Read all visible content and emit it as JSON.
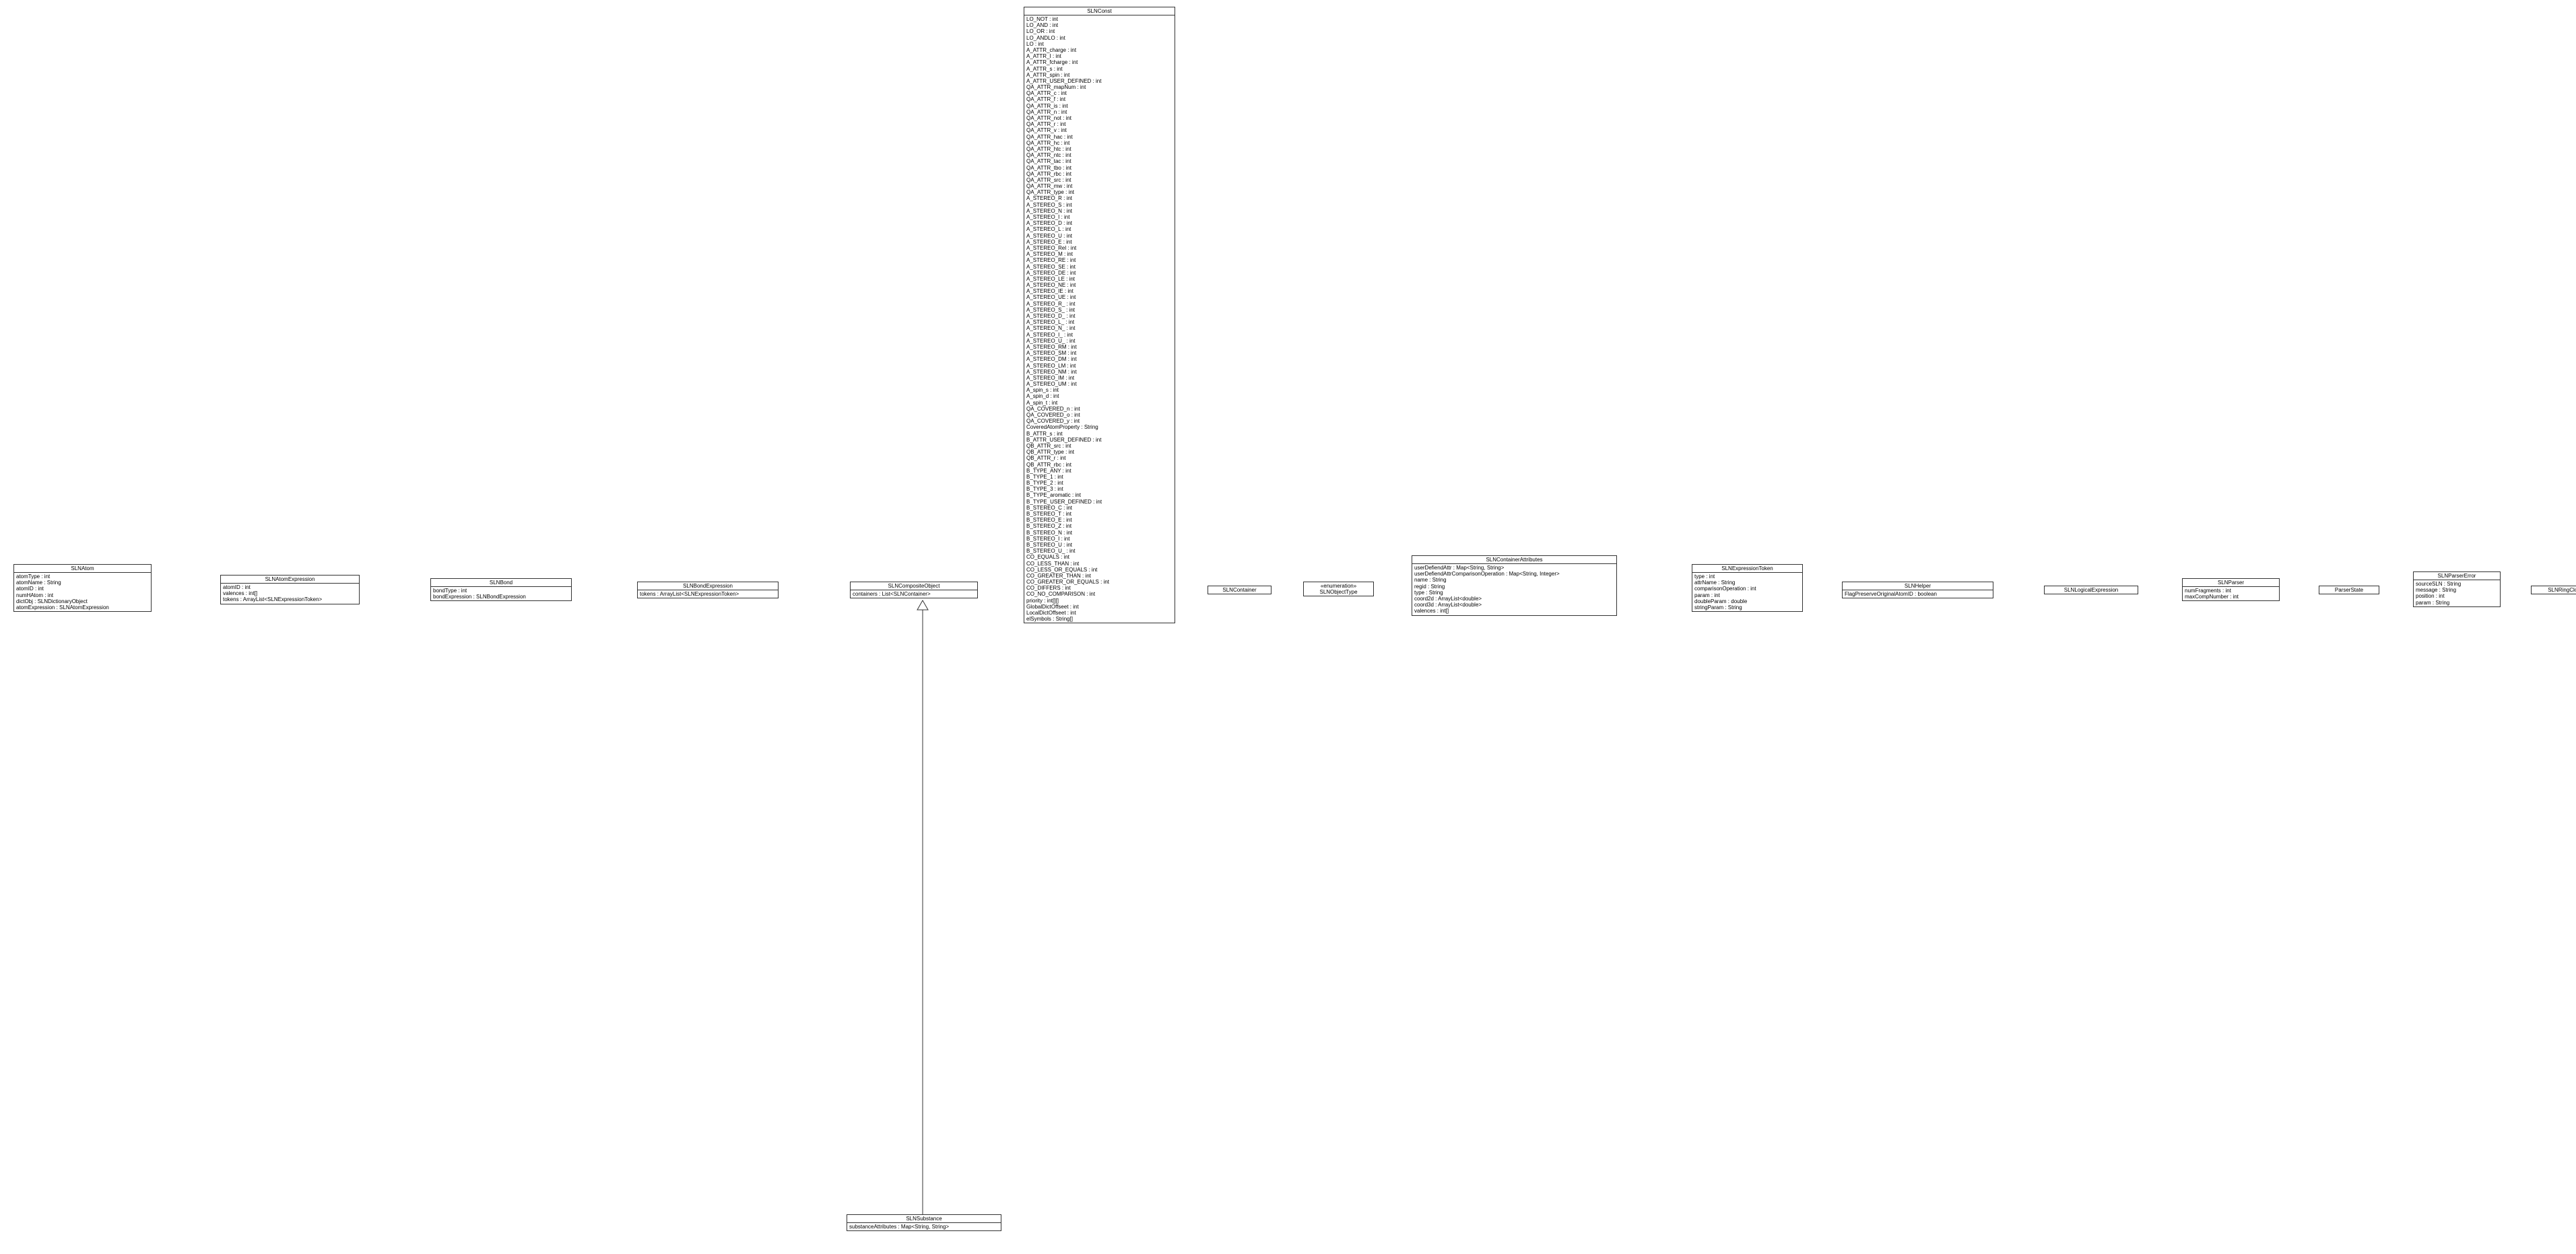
{
  "classes": {
    "SLNAtom": {
      "title": "SLNAtom",
      "attrs": [
        "atomType : int",
        "atomName : String",
        "atomID : int",
        "numHAtom : int",
        "dictObj : SLNDictionaryObject",
        "atomExpression : SLNAtomExpression"
      ]
    },
    "SLNAtomExpression": {
      "title": "SLNAtomExpression",
      "attrs": [
        "atomID : int",
        "valences : int[]",
        "tokens : ArrayList<SLNExpressionToken>"
      ]
    },
    "SLNBond": {
      "title": "SLNBond",
      "attrs": [
        "bondType : int",
        "bondExpression : SLNBondExpression"
      ]
    },
    "SLNBondExpression": {
      "title": "SLNBondExpression",
      "attrs": [
        "tokens : ArrayList<SLNExpressionToken>"
      ]
    },
    "SLNCompositeObject": {
      "title": "SLNCompositeObject",
      "attrs": [
        "containers : List<SLNContainer>"
      ]
    },
    "SLNConst": {
      "title": "SLNConst",
      "attrs": [
        "LO_NOT : int",
        "LO_AND : int",
        "LO_OR : int",
        "LO_ANDLO : int",
        "LO : int",
        "A_ATTR_charge : int",
        "A_ATTR_I : int",
        "A_ATTR_fcharge : int",
        "A_ATTR_s : int",
        "A_ATTR_spin : int",
        "A_ATTR_USER_DEFINED : int",
        "QA_ATTR_mapNum : int",
        "QA_ATTR_c : int",
        "QA_ATTR_f : int",
        "QA_ATTR_is : int",
        "QA_ATTR_n : int",
        "QA_ATTR_not : int",
        "QA_ATTR_r : int",
        "QA_ATTR_v : int",
        "QA_ATTR_hac : int",
        "QA_ATTR_hc : int",
        "QA_ATTR_htc : int",
        "QA_ATTR_ntc : int",
        "QA_ATTR_tac : int",
        "QA_ATTR_tbo : int",
        "QA_ATTR_rbc : int",
        "QA_ATTR_src : int",
        "QA_ATTR_mw : int",
        "QA_ATTR_type : int",
        "A_STEREO_R : int",
        "A_STEREO_S : int",
        "A_STEREO_N : int",
        "A_STEREO_I : int",
        "A_STEREO_D : int",
        "A_STEREO_L : int",
        "A_STEREO_U : int",
        "A_STEREO_E : int",
        "A_STEREO_Rel : int",
        "A_STEREO_M : int",
        "A_STEREO_RE : int",
        "A_STEREO_SE : int",
        "A_STEREO_DE : int",
        "A_STEREO_LE : int",
        "A_STEREO_NE : int",
        "A_STEREO_IE : int",
        "A_STEREO_UE : int",
        "A_STEREO_R_ : int",
        "A_STEREO_S_ : int",
        "A_STEREO_D_ : int",
        "A_STEREO_L_ : int",
        "A_STEREO_N_ : int",
        "A_STEREO_I_ : int",
        "A_STEREO_U_ : int",
        "A_STEREO_RM : int",
        "A_STEREO_SM : int",
        "A_STEREO_DM : int",
        "A_STEREO_LM : int",
        "A_STEREO_NM : int",
        "A_STEREO_IM : int",
        "A_STEREO_UM : int",
        "A_spin_s : int",
        "A_spin_d : int",
        "A_spin_t : int",
        "QA_COVERED_n : int",
        "QA_COVERED_o : int",
        "QA_COVERED_y : int",
        "CoveredAtomProperty : String",
        "B_ATTR_s : int",
        "B_ATTR_USER_DEFINED : int",
        "QB_ATTR_src : int",
        "QB_ATTR_type : int",
        "QB_ATTR_r : int",
        "QB_ATTR_rbc : int",
        "B_TYPE_ANY : int",
        "B_TYPE_1 : int",
        "B_TYPE_2 : int",
        "B_TYPE_3 : int",
        "B_TYPE_aromatic : int",
        "B_TYPE_USER_DEFINED : int",
        "B_STEREO_C : int",
        "B_STEREO_T : int",
        "B_STEREO_E : int",
        "B_STEREO_Z : int",
        "B_STEREO_N : int",
        "B_STEREO_I : int",
        "B_STEREO_U : int",
        "B_STEREO_U_ : int",
        "CO_EQUALS : int",
        "CO_LESS_THAN : int",
        "CO_LESS_OR_EQUALS : int",
        "CO_GREATER_THAN : int",
        "CO_GREATER_OR_EQUALS : int",
        "CO_DIFFERS : int",
        "CO_NO_COMPARISON : int",
        "priority : int[][]",
        "GlobalDictOffseet : int",
        "LocalDictOffseet : int",
        "elSymbols : String[]"
      ]
    },
    "SLNContainer": {
      "title": "SLNContainer",
      "attrs": []
    },
    "SLNObjectType": {
      "stereo": "«enumeration»",
      "title": "SLNObjectType",
      "attrs": []
    },
    "SLNContainerAttributes": {
      "title": "SLNContainerAttributes",
      "attrs": [
        "userDefiendAttr : Map<String, String>",
        "userDefiendAttrComparisonOperation : Map<String, Integer>",
        "name : String",
        "regid : String",
        "type : String",
        "coord2d : ArrayList<double>",
        "coord3d : ArrayList<double>",
        "valences : int[]"
      ]
    },
    "SLNExpressionToken": {
      "title": "SLNExpressionToken",
      "attrs": [
        "type : int",
        "attrName : String",
        "comparisonOperation : int",
        "param : int",
        "doubleParam : double",
        "stringParam : String"
      ]
    },
    "SLNHelper": {
      "title": "SLNHelper",
      "attrs": [
        "FlagPreserveOriginalAtomID : boolean"
      ]
    },
    "SLNLogicalExpression": {
      "title": "SLNLogicalExpression",
      "attrs": []
    },
    "SLNParser": {
      "title": "SLNParser",
      "attrs": [
        "numFragments : int",
        "maxCompNumber : int"
      ]
    },
    "ParserState": {
      "title": "ParserState",
      "attrs": []
    },
    "SLNParserError": {
      "title": "SLNParserError",
      "attrs": [
        "sourceSLN : String",
        "message : String",
        "position : int",
        "param : String"
      ]
    },
    "SLNRingClosure": {
      "title": "SLNRingClosure",
      "attrs": []
    },
    "SLNSubstance": {
      "title": "SLNSubstance",
      "attrs": [
        "substanceAttributes : Map<String, String>"
      ]
    }
  }
}
